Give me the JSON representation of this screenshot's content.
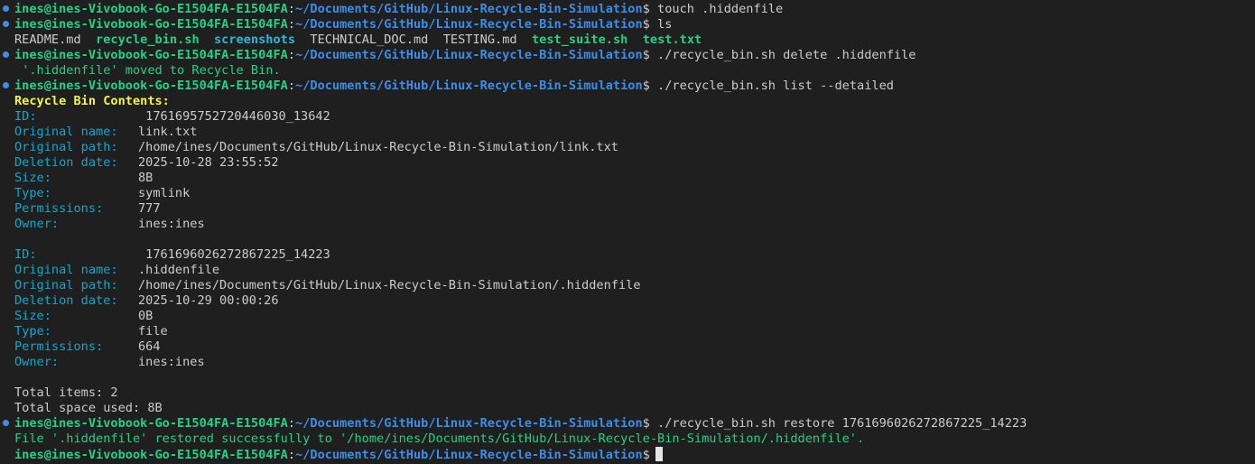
{
  "prompt": {
    "user": "ines@ines-Vivobook-Go-E1504FA-E1504FA",
    "sep": ":",
    "path": "~/Documents/GitHub/Linux-Recycle-Bin-Simulation",
    "sign": "$"
  },
  "commands": {
    "touch": "touch .hiddenfile",
    "ls": "ls",
    "delete": "./recycle_bin.sh delete .hiddenfile",
    "list": "./recycle_bin.sh list --detailed",
    "restore": "./recycle_bin.sh restore 1761696026272867225_14223"
  },
  "ls_output": {
    "readme": "README.md",
    "recycle_bin": "recycle_bin.sh",
    "screenshots": "screenshots",
    "technical_doc": "TECHNICAL_DOC.md",
    "testing": "TESTING.md",
    "test_suite": "test_suite.sh",
    "test_txt": "test.txt"
  },
  "delete_msg": " '.hiddenfile' moved to Recycle Bin.",
  "contents_header": "Recycle Bin Contents:",
  "labels": {
    "id": "ID:",
    "original_name": "Original name:",
    "original_path": "Original path:",
    "deletion_date": "Deletion date:",
    "size": "Size:",
    "type": "Type:",
    "permissions": "Permissions:",
    "owner": "Owner:"
  },
  "entries": [
    {
      "id": " 1761695752720446030_13642",
      "original_name": "link.txt",
      "original_path": "/home/ines/Documents/GitHub/Linux-Recycle-Bin-Simulation/link.txt",
      "deletion_date": "2025-10-28 23:55:52",
      "size": "8B",
      "type": "symlink",
      "permissions": "777",
      "owner": "ines:ines"
    },
    {
      "id": " 1761696026272867225_14223",
      "original_name": ".hiddenfile",
      "original_path": "/home/ines/Documents/GitHub/Linux-Recycle-Bin-Simulation/.hiddenfile",
      "deletion_date": "2025-10-29 00:00:26",
      "size": "0B",
      "type": "file",
      "permissions": "664",
      "owner": "ines:ines"
    }
  ],
  "totals": {
    "items": "Total items: 2",
    "space": "Total space used: 8B"
  },
  "restore_msg": "File '.hiddenfile' restored successfully to '/home/ines/Documents/GitHub/Linux-Recycle-Bin-Simulation/.hiddenfile'.",
  "colors": {
    "background": "#1f1f1f",
    "user": "#23d18b",
    "path": "#3b8eea",
    "label": "#11a8cd",
    "header": "#f5f543",
    "dot": "#3b8eea"
  }
}
